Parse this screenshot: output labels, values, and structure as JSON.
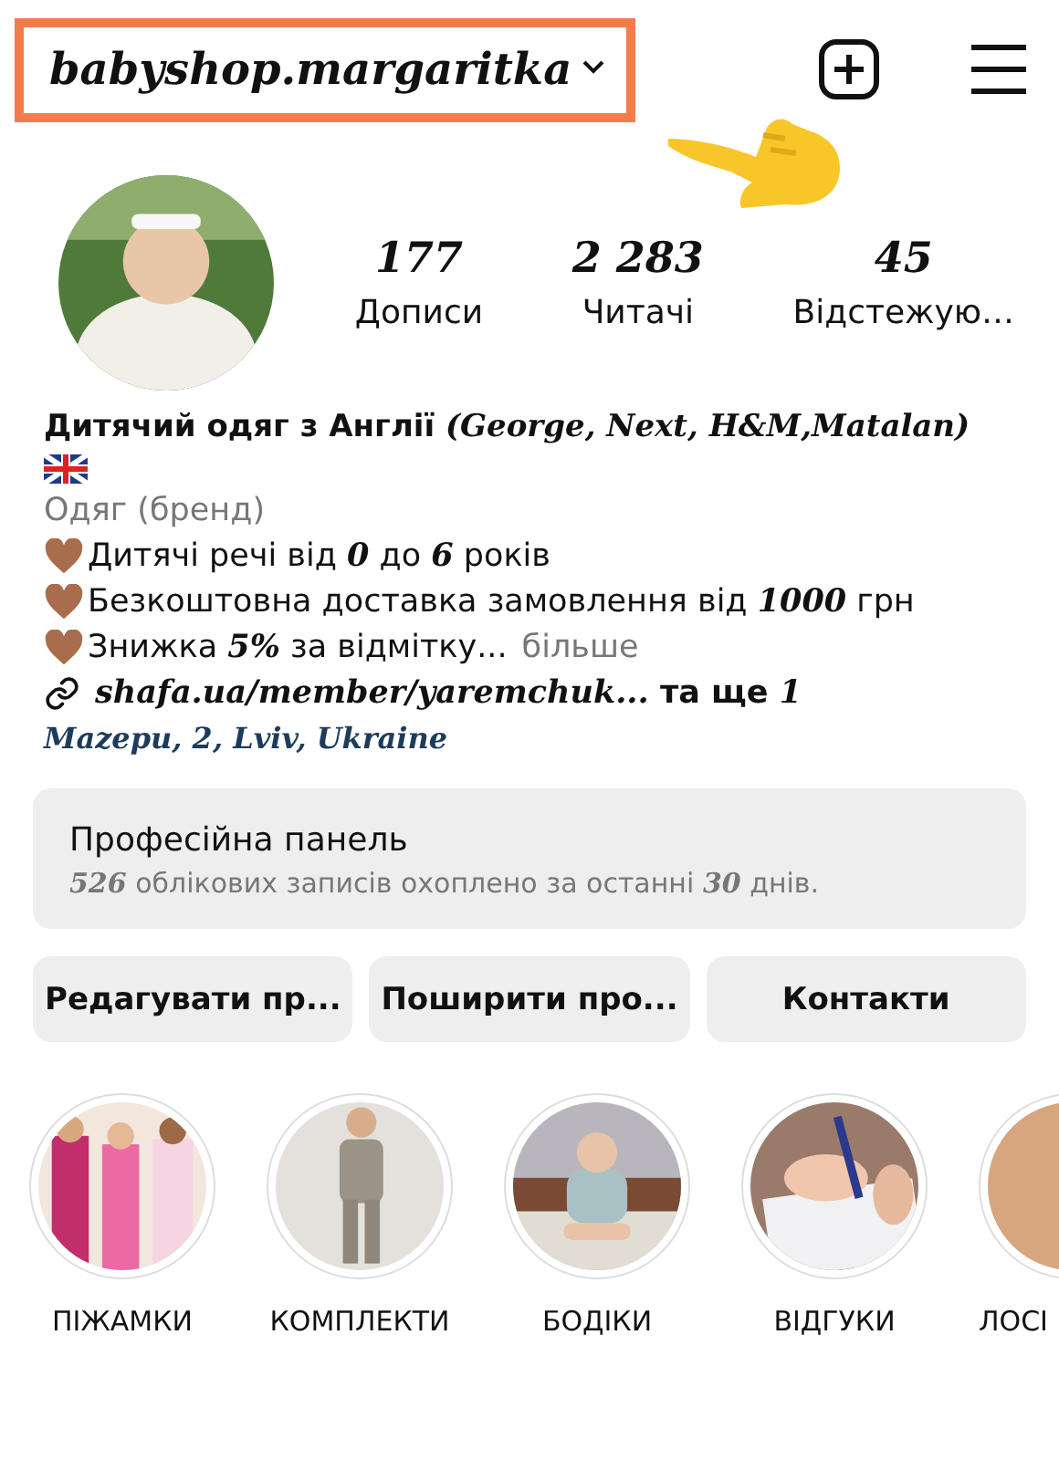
{
  "header": {
    "username": "babyshop.margaritka",
    "highlighted": true
  },
  "stats": [
    {
      "value": "177",
      "label": "Дописи"
    },
    {
      "value": "2 283",
      "label": "Читачі"
    },
    {
      "value": "45",
      "label": "Відстежую…"
    }
  ],
  "bio": {
    "name": "Дитячий одяг з Англії **(George, Next, H&M,Matalan)**",
    "category": "Одяг (бренд)",
    "lines": [
      {
        "kind": "heart",
        "text": "Дитячі речі від **0** до **6** років"
      },
      {
        "kind": "heart",
        "text": "Безкоштовна доставка замовлення від **1000** грн"
      },
      {
        "kind": "heart",
        "text": "Знижка **5%** за відмітку...",
        "more": "більше"
      }
    ],
    "link": "**shafa.ua/member/yaremchuk...** та ще **1**",
    "location": "Mazepu, 2, Lviv, Ukraine"
  },
  "dashboard": {
    "title": "Професійна панель",
    "subtitle": "**526** облікових записів охоплено за останні **30** днів."
  },
  "buttons": [
    "Редагувати пр...",
    "Поширити про...",
    "Контакти"
  ],
  "highlights": [
    {
      "label": "ПІЖАМКИ",
      "kind": "picture"
    },
    {
      "label": "КОМПЛЕКТИ",
      "kind": "picture"
    },
    {
      "label": "БОДІКИ",
      "kind": "picture"
    },
    {
      "label": "ВІДГУКИ",
      "kind": "picture"
    },
    {
      "label": "ЛОСІ",
      "kind": "picture"
    }
  ]
}
